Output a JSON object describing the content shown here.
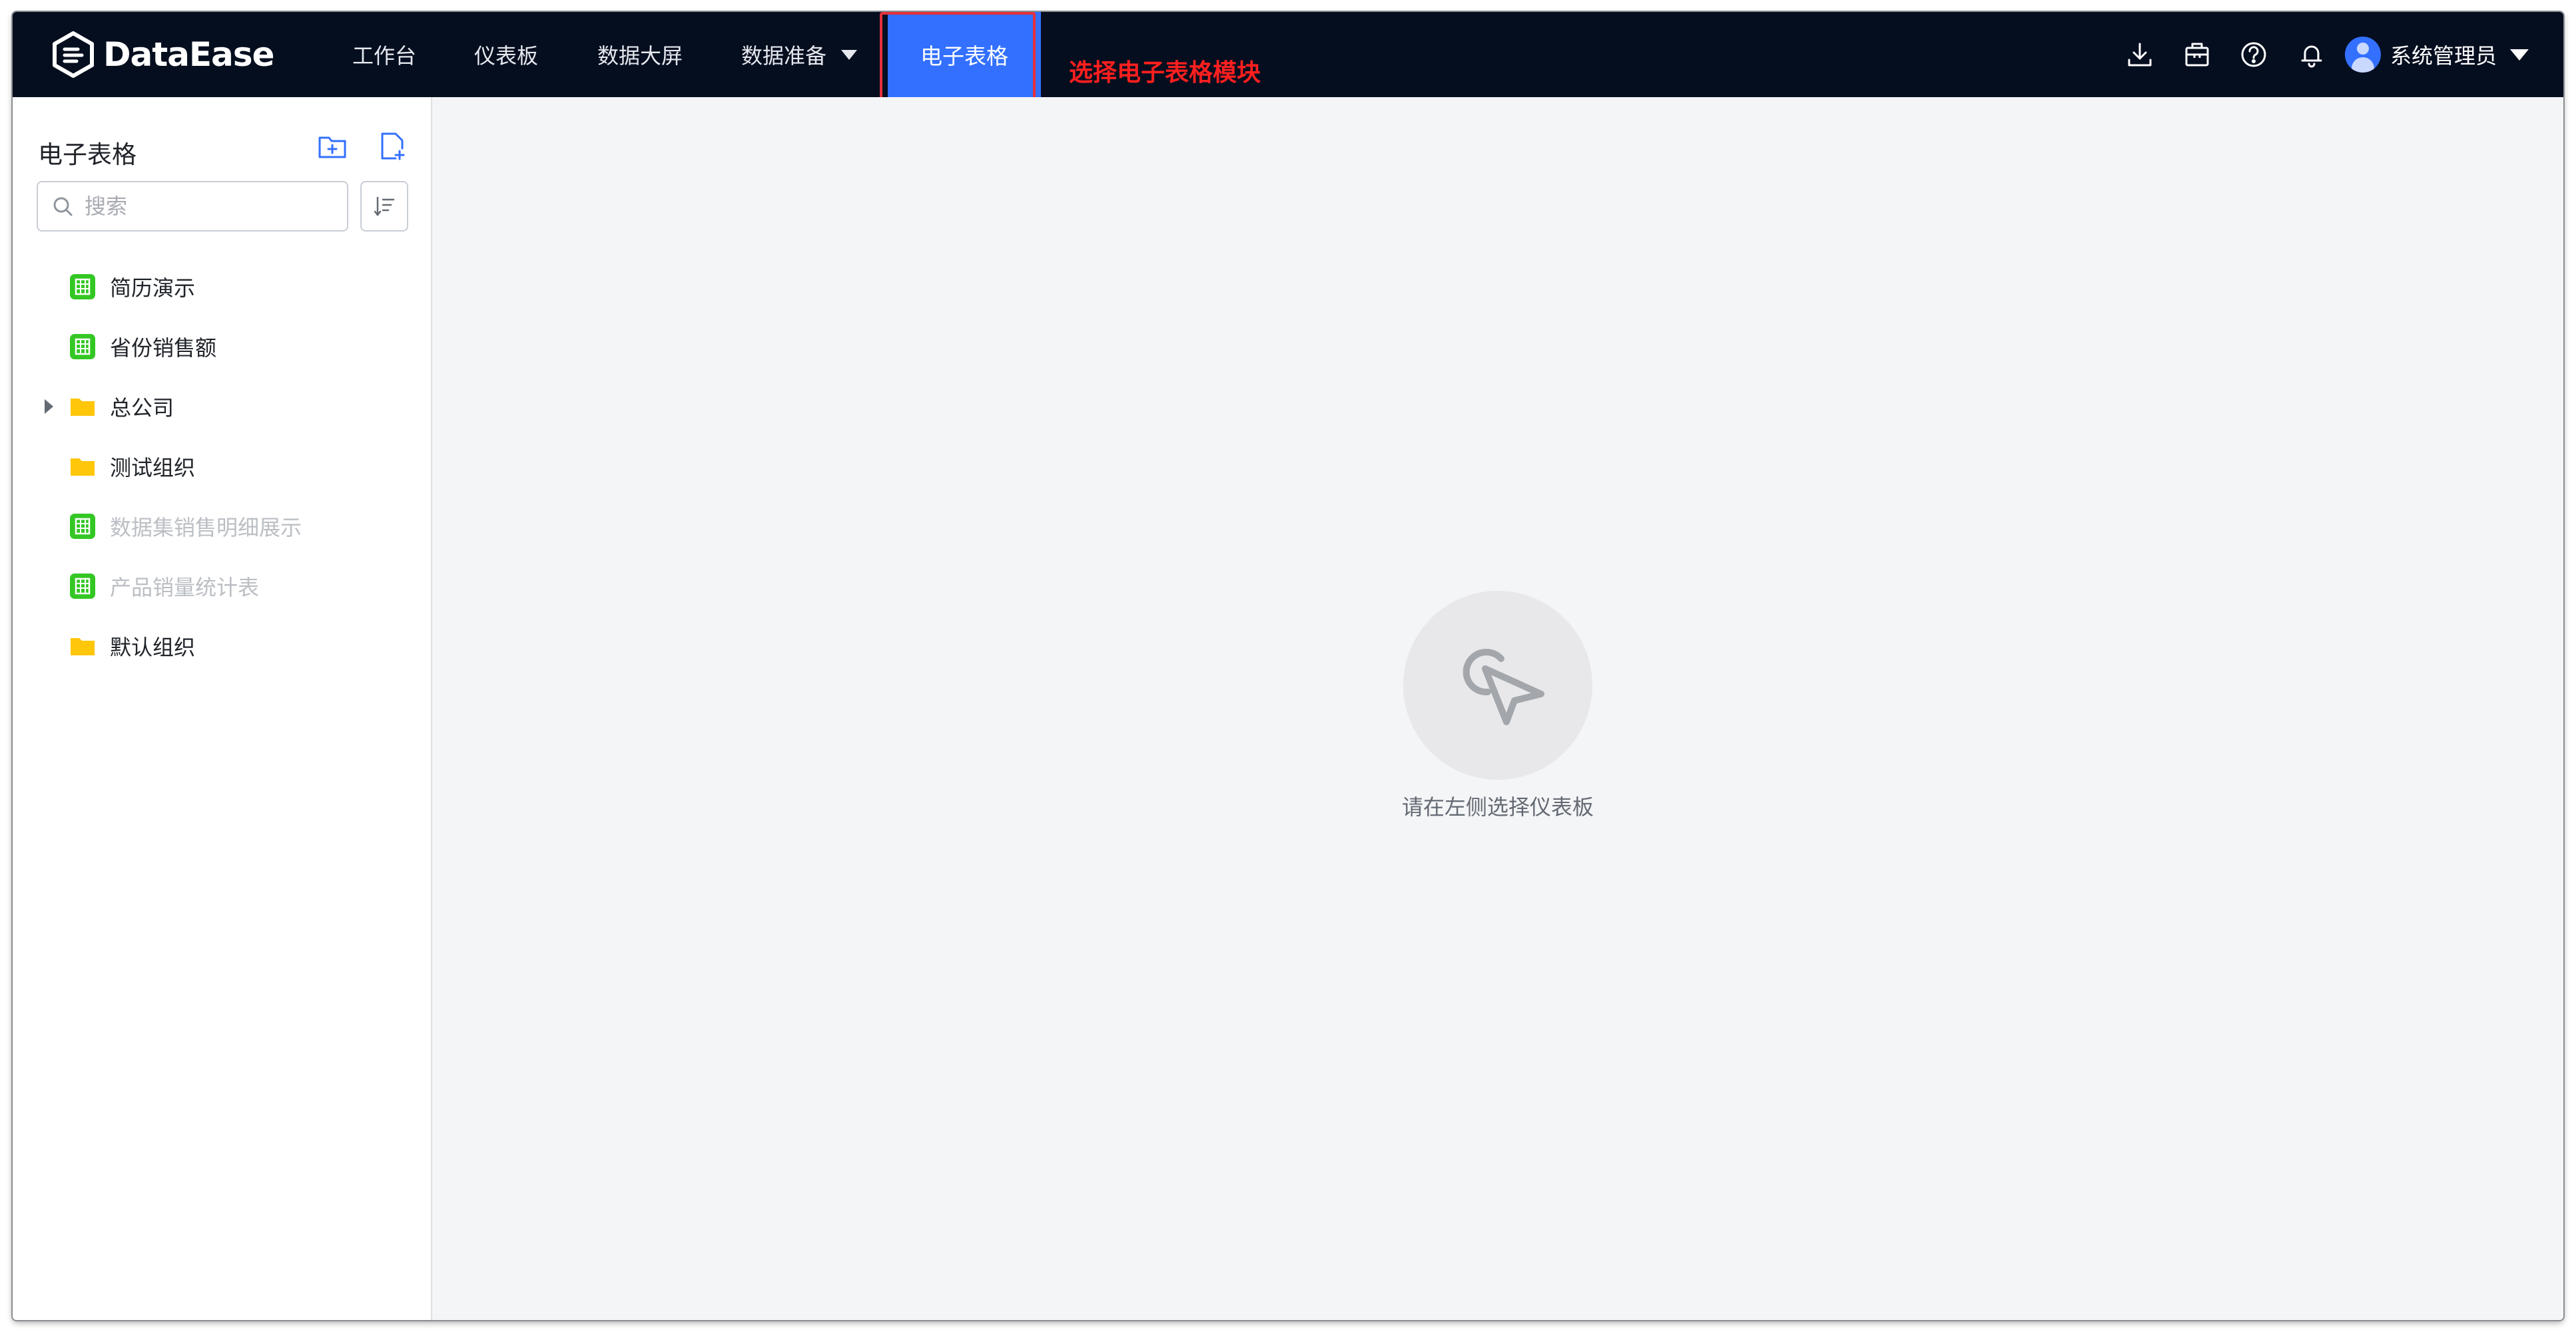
{
  "app": {
    "brand": "DataEase"
  },
  "nav": {
    "items": [
      {
        "label": "工作台"
      },
      {
        "label": "仪表板"
      },
      {
        "label": "数据大屏"
      },
      {
        "label": "数据准备"
      }
    ],
    "active": {
      "label": "电子表格"
    }
  },
  "annotation": {
    "text": "选择电子表格模块"
  },
  "user": {
    "name": "系统管理员"
  },
  "sidebar": {
    "title": "电子表格",
    "search_placeholder": "搜索",
    "items": [
      {
        "label": "简历演示",
        "type": "sheet",
        "disabled": false
      },
      {
        "label": "省份销售额",
        "type": "sheet",
        "disabled": false
      },
      {
        "label": "总公司",
        "type": "folder",
        "expandable": true
      },
      {
        "label": "测试组织",
        "type": "folder"
      },
      {
        "label": "数据集销售明细展示",
        "type": "sheet",
        "disabled": true
      },
      {
        "label": "产品销量统计表",
        "type": "sheet",
        "disabled": true
      },
      {
        "label": "默认组织",
        "type": "folder"
      }
    ]
  },
  "empty_state": {
    "text": "请在左侧选择仪表板"
  },
  "colors": {
    "topbar": "#050e1f",
    "accent": "#3370ff",
    "annotation": "#ff1f1f",
    "sheet_icon": "#34c724",
    "folder_icon": "#ffc60a"
  }
}
